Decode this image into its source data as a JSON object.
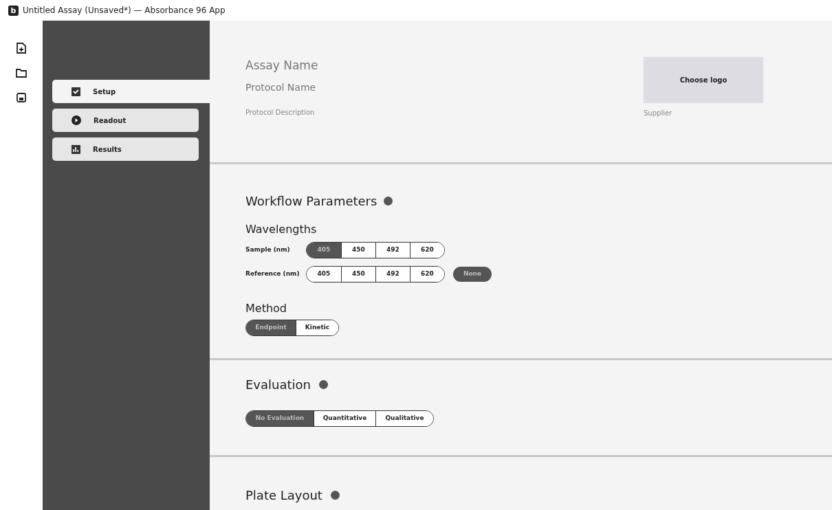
{
  "window": {
    "title": "Untitled Assay (Unsaved*) — Absorbance 96 App",
    "app_icon_letter": "b"
  },
  "nav": [
    {
      "label": "Setup",
      "selected": true,
      "kind": "setup"
    },
    {
      "label": "Readout",
      "selected": false,
      "kind": "readout"
    },
    {
      "label": "Results",
      "selected": false,
      "kind": "results"
    }
  ],
  "header": {
    "assay_name": {
      "placeholder": "Assay Name"
    },
    "protocol_name": {
      "placeholder": "Protocol Name"
    },
    "protocol_description": {
      "placeholder": "Protocol Description"
    },
    "logo_button": "Choose logo",
    "supplier": {
      "placeholder": "Supplier"
    }
  },
  "workflow": {
    "title": "Workflow Parameters",
    "wavelengths": {
      "title": "Wavelengths",
      "rows": [
        {
          "label": "Sample (nm)",
          "options": [
            {
              "label": "405",
              "selected": true
            },
            {
              "label": "450",
              "selected": false
            },
            {
              "label": "492",
              "selected": false
            },
            {
              "label": "620",
              "selected": false
            }
          ]
        },
        {
          "label": "Reference (nm)",
          "options": [
            {
              "label": "405",
              "selected": false
            },
            {
              "label": "450",
              "selected": false
            },
            {
              "label": "492",
              "selected": false
            },
            {
              "label": "620",
              "selected": false
            }
          ],
          "none": {
            "label": "None",
            "selected": true
          }
        }
      ]
    },
    "method": {
      "title": "Method",
      "options": [
        {
          "label": "Endpoint",
          "selected": true
        },
        {
          "label": "Kinetic",
          "selected": false
        }
      ]
    }
  },
  "evaluation": {
    "title": "Evaluation",
    "options": [
      {
        "label": "No Evaluation",
        "selected": true
      },
      {
        "label": "Quantitative",
        "selected": false
      },
      {
        "label": "Qualitative",
        "selected": false
      }
    ]
  },
  "plate_layout": {
    "title": "Plate Layout"
  }
}
